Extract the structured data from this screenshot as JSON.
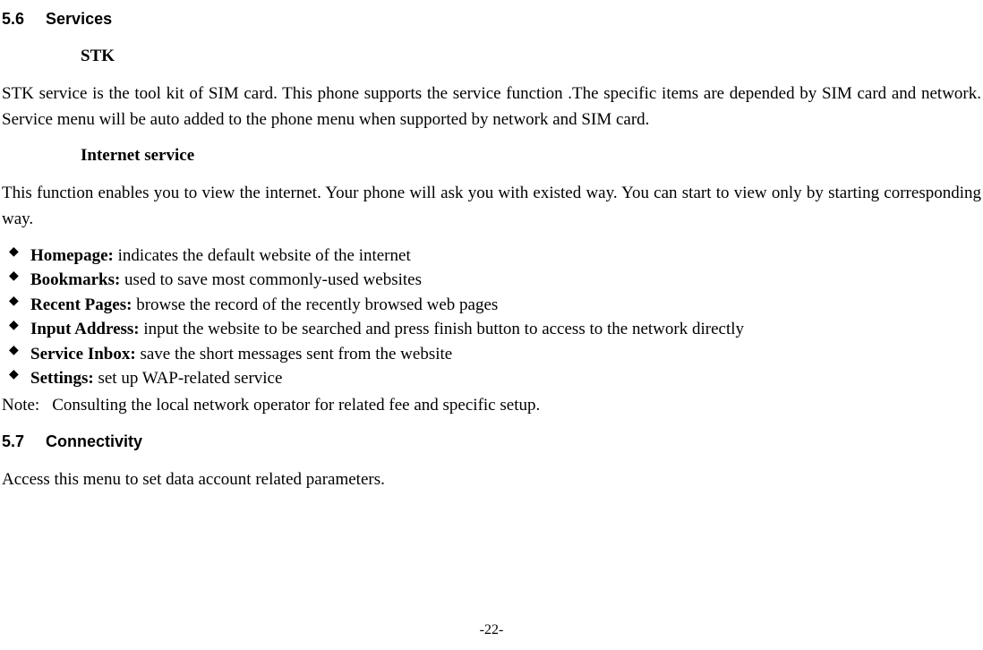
{
  "section56": {
    "number": "5.6",
    "title": "Services"
  },
  "stk": {
    "heading": "STK",
    "paragraph": "STK service is the tool kit of SIM card. This phone supports the service function .The specific items are depended by SIM card and network. Service menu will be auto added to the phone menu when supported by network and SIM card."
  },
  "internet": {
    "heading": "Internet service",
    "paragraph": "This function enables you to view the internet. Your phone will ask you with existed way. You can start to view only by starting corresponding way.",
    "bullets": [
      {
        "label": "Homepage:",
        "text": " indicates the default website of the internet"
      },
      {
        "label": "Bookmarks:",
        "text": " used to save most commonly-used websites"
      },
      {
        "label": "Recent Pages:",
        "text": " browse the record of the recently browsed web pages"
      },
      {
        "label": "Input Address:",
        "text": " input the website to be searched and press finish button to access to the network directly"
      },
      {
        "label": "Service Inbox:",
        "text": " save the short messages sent from the website"
      },
      {
        "label": "Settings:",
        "text": " set up WAP-related service"
      }
    ],
    "note_label": "Note:",
    "note_text": "Consulting the local network operator for related fee and specific setup."
  },
  "section57": {
    "number": "5.7",
    "title": "Connectivity",
    "paragraph": "Access this menu to set data account related parameters."
  },
  "page_number": "-22-"
}
